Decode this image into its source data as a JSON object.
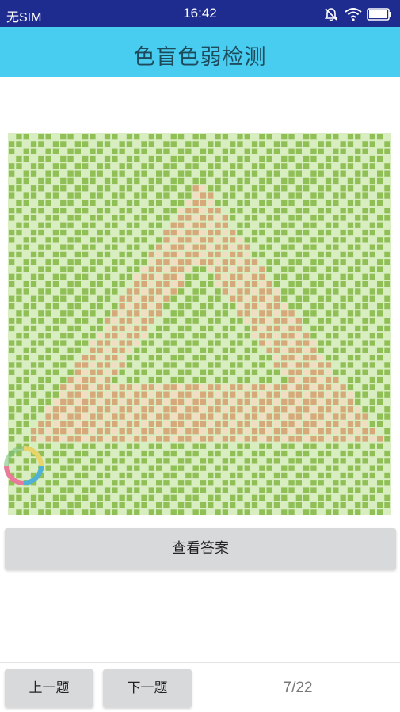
{
  "status_bar": {
    "carrier": "无SIM",
    "time": "16:42",
    "icons": [
      "alarm-off-icon",
      "wifi-icon",
      "battery-icon"
    ]
  },
  "app": {
    "title": "色盲色弱检测"
  },
  "test_plate": {
    "figure": "triangle",
    "colors": {
      "background": "#8fbf55",
      "background_light": "#d8edc0",
      "figure": "#d7a97a",
      "figure_light": "#f2ddc3"
    }
  },
  "actions": {
    "show_answer_label": "查看答案",
    "prev_label": "上一题",
    "next_label": "下一题"
  },
  "progress": {
    "text": "7/22"
  },
  "colors": {
    "status_bar": "#1f2c8f",
    "title_bar": "#48cdf0",
    "button": "#d8d9da"
  }
}
